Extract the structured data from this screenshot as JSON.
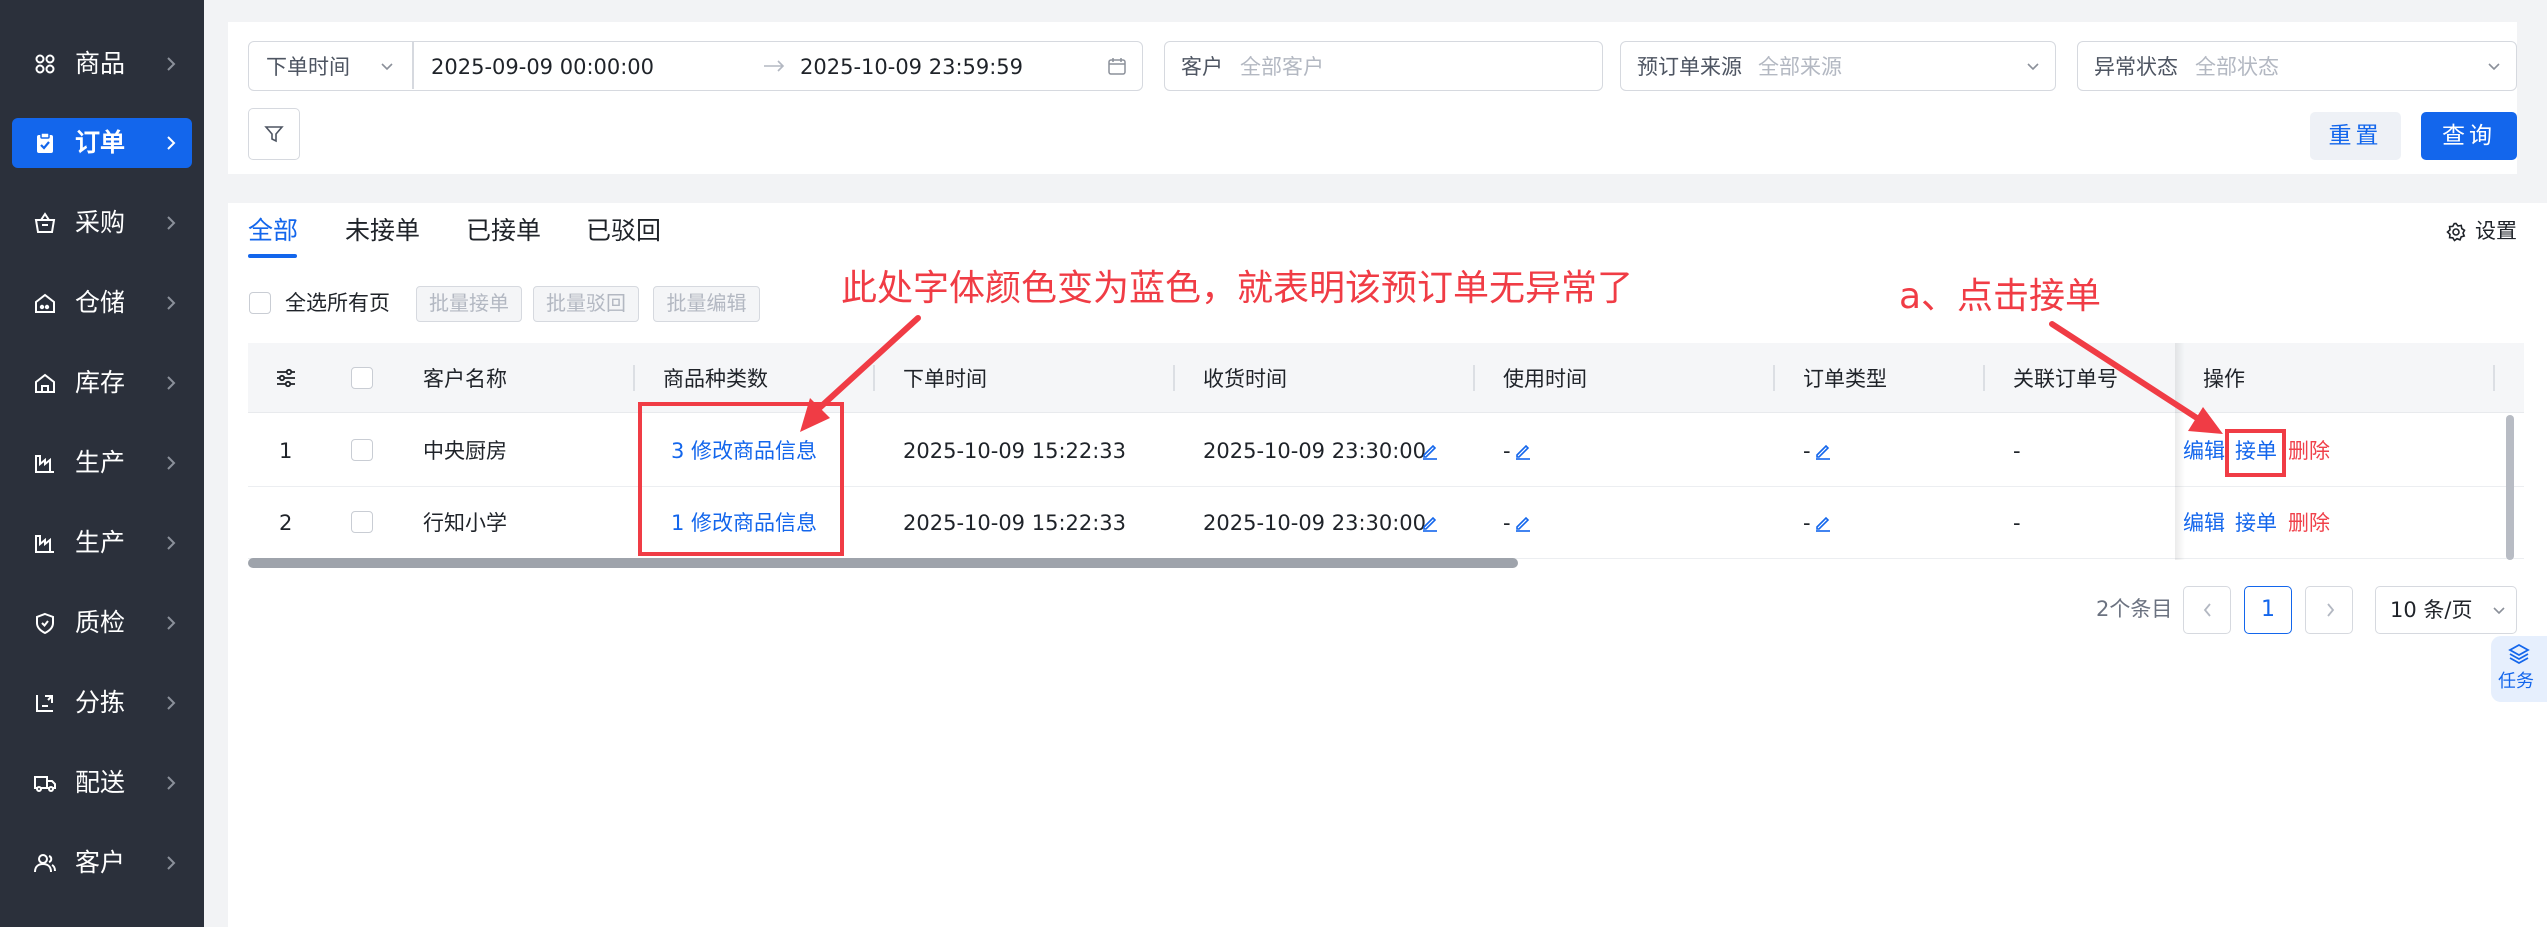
{
  "sidebar": {
    "items": [
      {
        "label": "商品",
        "icon": "grid-icon"
      },
      {
        "label": "订单",
        "icon": "clipboard-icon"
      },
      {
        "label": "采购",
        "icon": "basket-icon"
      },
      {
        "label": "仓储",
        "icon": "house-icon"
      },
      {
        "label": "库存",
        "icon": "house-icon"
      },
      {
        "label": "生产",
        "icon": "factory-icon"
      },
      {
        "label": "生产",
        "icon": "factory-icon"
      },
      {
        "label": "质检",
        "icon": "shield-icon"
      },
      {
        "label": "分拣",
        "icon": "sort-icon"
      },
      {
        "label": "配送",
        "icon": "truck-icon"
      },
      {
        "label": "客户",
        "icon": "user-icon"
      }
    ],
    "active": "订单"
  },
  "filters": {
    "time_type": "下单时间",
    "start": "2025-09-09 00:00:00",
    "end": "2025-10-09 23:59:59",
    "customer_label": "客户",
    "customer_placeholder": "全部客户",
    "source_label": "预订单来源",
    "source_placeholder": "全部来源",
    "status_label": "异常状态",
    "status_placeholder": "全部状态",
    "reset": "重置",
    "query": "查询"
  },
  "tabs": [
    "全部",
    "未接单",
    "已接单",
    "已驳回"
  ],
  "settings_label": "设置",
  "toolbar": {
    "select_all": "全选所有页",
    "batch_accept": "批量接单",
    "batch_reject": "批量驳回",
    "batch_edit": "批量编辑"
  },
  "table": {
    "headers": [
      "客户名称",
      "商品种类数",
      "下单时间",
      "收货时间",
      "使用时间",
      "订单类型",
      "关联订单号",
      "操作"
    ],
    "rows": [
      {
        "index": "1",
        "customer": "中央厨房",
        "goods": "3 修改商品信息",
        "order_time": "2025-10-09 15:22:33",
        "receive_time": "2025-10-09 23:30:00",
        "use_time": "-",
        "order_type": "-",
        "related_no": "-",
        "edit": "编辑",
        "accept": "接单",
        "delete": "删除"
      },
      {
        "index": "2",
        "customer": "行知小学",
        "goods": "1 修改商品信息",
        "order_time": "2025-10-09 15:22:33",
        "receive_time": "2025-10-09 23:30:00",
        "use_time": "-",
        "order_type": "-",
        "related_no": "-",
        "edit": "编辑",
        "accept": "接单",
        "delete": "删除"
      }
    ]
  },
  "pagination": {
    "total": "2个条目",
    "current": "1",
    "page_size": "10 条/页"
  },
  "task_label": "任务",
  "annotations": {
    "note1": "此处字体颜色变为蓝色，就表明该预订单无异常了",
    "note2": "a、点击接单"
  },
  "colors": {
    "primary": "#1366ec",
    "danger": "#f0414b",
    "sidebar_bg": "#2b303b",
    "annotation": "#f03c45"
  }
}
